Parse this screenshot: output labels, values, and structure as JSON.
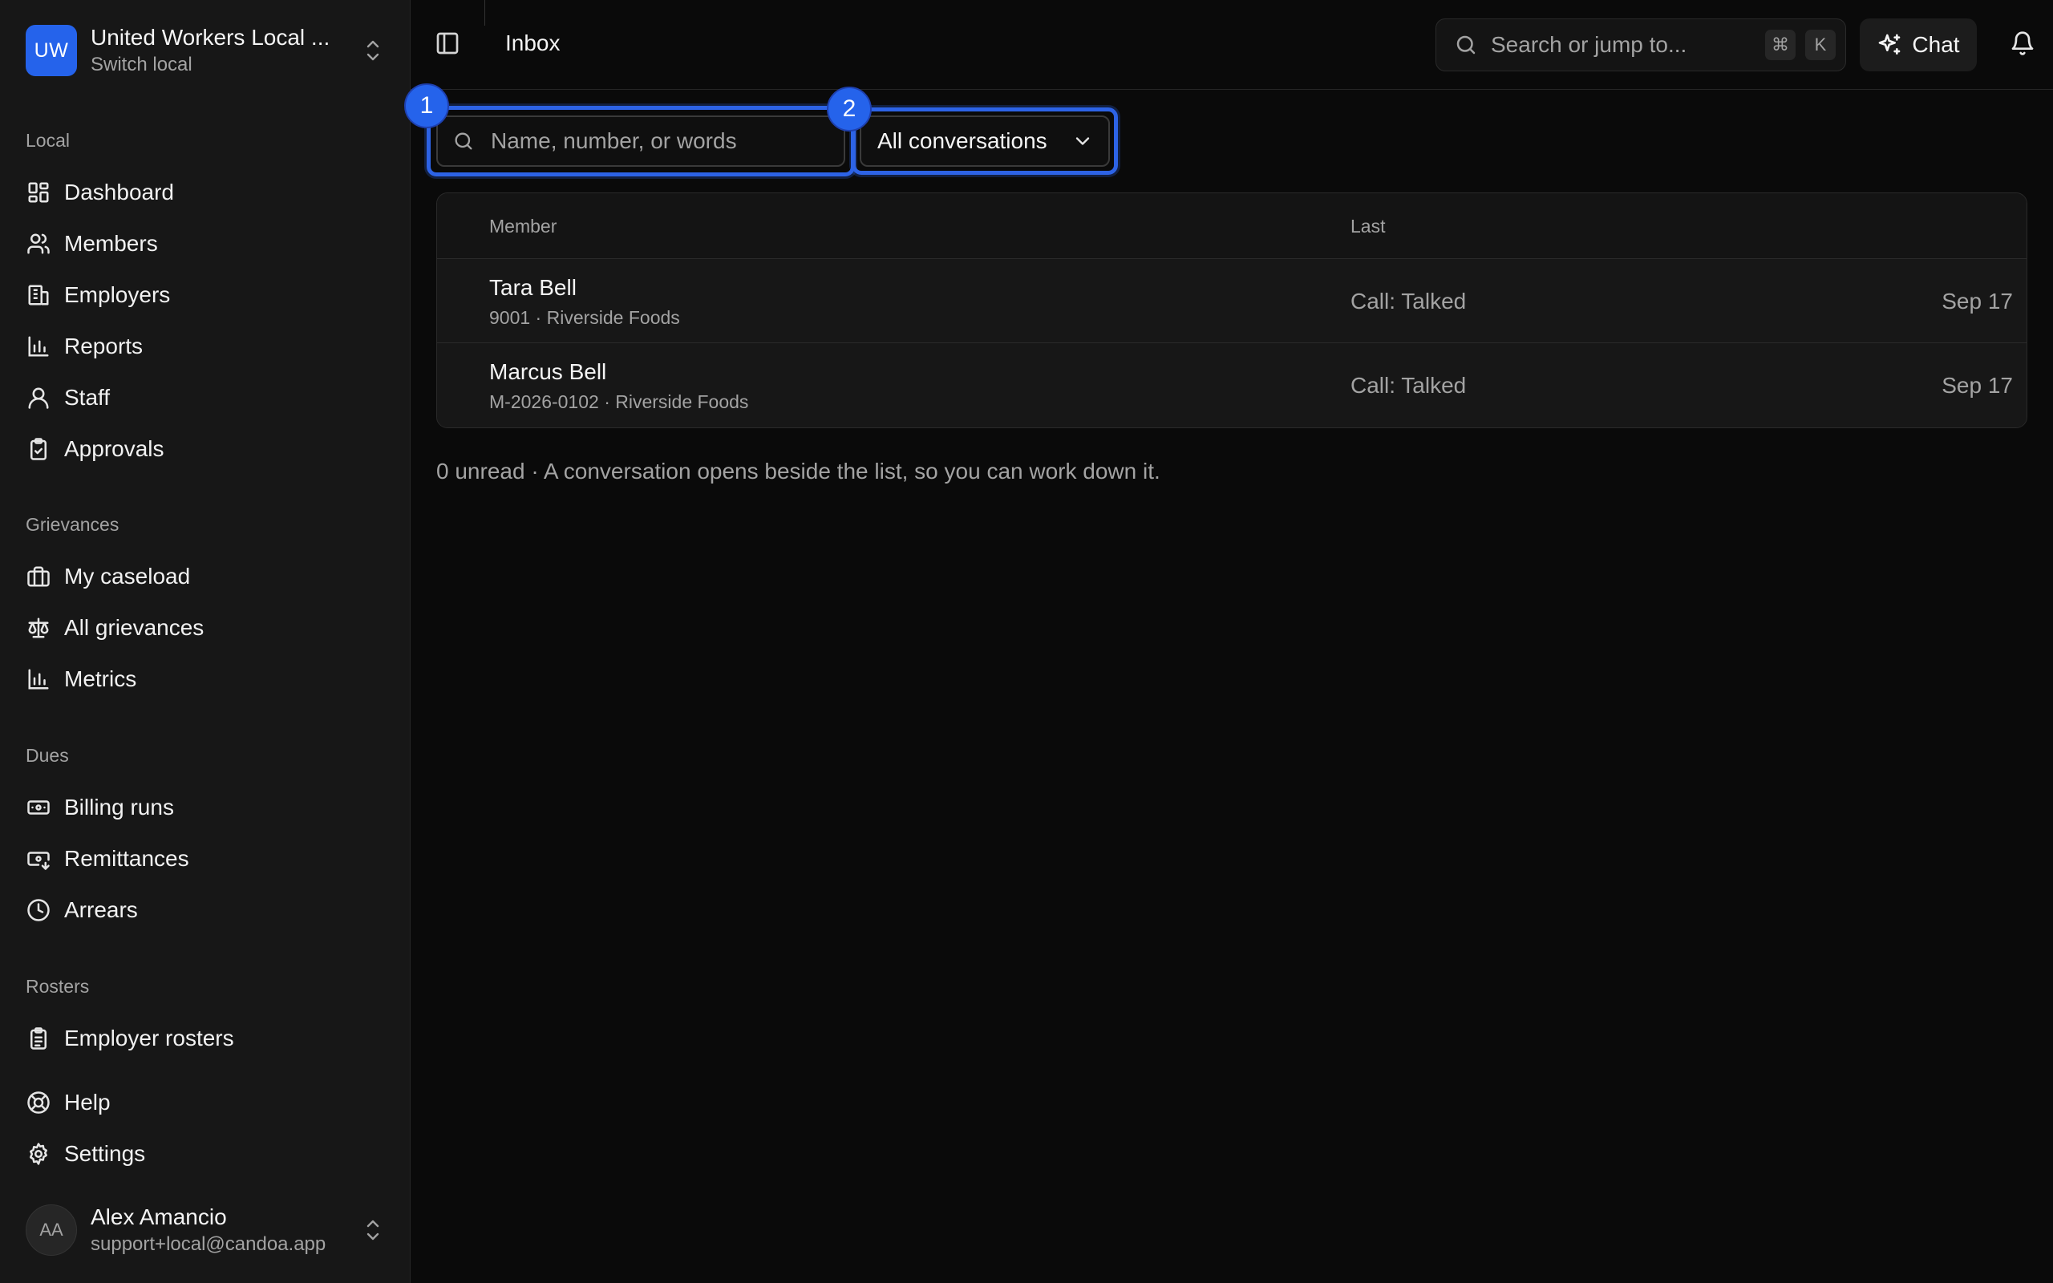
{
  "org": {
    "initials": "UW",
    "name": "United Workers Local ...",
    "subtitle": "Switch local"
  },
  "sidebar": {
    "sections": {
      "local": "Local",
      "grievances": "Grievances",
      "dues": "Dues",
      "rosters": "Rosters"
    },
    "items": {
      "dashboard": "Dashboard",
      "members": "Members",
      "employers": "Employers",
      "reports": "Reports",
      "staff": "Staff",
      "approvals": "Approvals",
      "my_caseload": "My caseload",
      "all_grievances": "All grievances",
      "metrics": "Metrics",
      "billing_runs": "Billing runs",
      "remittances": "Remittances",
      "arrears": "Arrears",
      "employer_rosters": "Employer rosters",
      "help": "Help",
      "settings": "Settings"
    }
  },
  "user": {
    "initials": "AA",
    "name": "Alex Amancio",
    "email": "support+local@candoa.app"
  },
  "header": {
    "title": "Inbox",
    "search_placeholder": "Search or jump to...",
    "shortcut_mod": "⌘",
    "shortcut_key": "K",
    "chat_label": "Chat"
  },
  "filters": {
    "search_placeholder": "Name, number, or words",
    "search_value": "",
    "conversation_filter": "All conversations",
    "annotations": [
      "1",
      "2"
    ]
  },
  "table": {
    "columns": {
      "member": "Member",
      "last": "Last"
    },
    "rows": [
      {
        "name": "Tara Bell",
        "sub": "9001 · Riverside Foods",
        "last": "Call: Talked",
        "date": "Sep 17"
      },
      {
        "name": "Marcus Bell",
        "sub": "M-2026-0102 · Riverside Foods",
        "last": "Call: Talked",
        "date": "Sep 17"
      }
    ]
  },
  "footer_note": "0 unread · A conversation opens beside the list, so you can work down it.",
  "colors": {
    "accent": "#2563eb",
    "background": "#0a0a0a",
    "sidebar": "#171717"
  }
}
